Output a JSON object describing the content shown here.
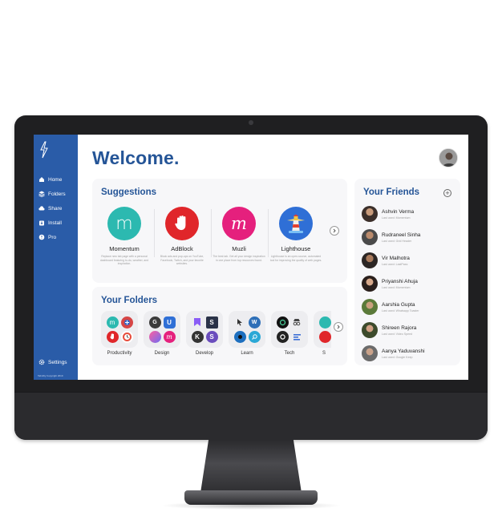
{
  "sidebar": {
    "items": [
      {
        "label": "Home",
        "icon": "home-icon"
      },
      {
        "label": "Folders",
        "icon": "layers-icon"
      },
      {
        "label": "Share",
        "icon": "cloud-icon"
      },
      {
        "label": "Install",
        "icon": "install-icon"
      },
      {
        "label": "Pro",
        "icon": "pro-icon"
      }
    ],
    "settings_label": "Settings",
    "copyright": "Tabnifty Copyright 2019"
  },
  "main": {
    "welcome": "Welcome."
  },
  "suggestions": {
    "title": "Suggestions",
    "items": [
      {
        "name": "Momentum",
        "description": "Replace new tab page with a personal dashboard featuring to-do, weather, and inspiration.",
        "color": "#2cb9b0",
        "glyph": "m"
      },
      {
        "name": "AdBlock",
        "description": "Block ads and pop-ups on YouTube, Facebook, Twitch, and your favorite websites.",
        "color": "#e0262a",
        "glyph": "hand"
      },
      {
        "name": "Muzli",
        "description": "The best tab. Get all your design inspiration in one place from top resources found.",
        "color": "#e5207d",
        "glyph": "M"
      },
      {
        "name": "Lighthouse",
        "description": "Lighthouse is an open-source, automated tool for improving the quality of web pages.",
        "color": "#2f6fd6",
        "glyph": "lighthouse"
      }
    ]
  },
  "folders": {
    "title": "Your Folders",
    "items": [
      {
        "name": "Productivity"
      },
      {
        "name": "Design"
      },
      {
        "name": "Develop"
      },
      {
        "name": "Learn"
      },
      {
        "name": "Tech"
      },
      {
        "name": "S"
      }
    ]
  },
  "friends": {
    "title": "Your Friends",
    "items": [
      {
        "name": "Ashvin Verma",
        "last_used": "Last used: Momentum"
      },
      {
        "name": "Rudraneel Sinha",
        "last_used": "Last used: Grid Header"
      },
      {
        "name": "Vir Malhotra",
        "last_used": "Last used: LastPass"
      },
      {
        "name": "Priyanshi Ahuja",
        "last_used": "Last used: Momentum"
      },
      {
        "name": "Aarshia Gupta",
        "last_used": "Last used: Whatsapp Toaster"
      },
      {
        "name": "Shireen Rajora",
        "last_used": "Last used: Video Speed"
      },
      {
        "name": "Aanya Yaduvanshi",
        "last_used": "Last used: Google Keep"
      }
    ]
  },
  "colors": {
    "sidebar": "#2a5ca8",
    "accent": "#255597"
  }
}
